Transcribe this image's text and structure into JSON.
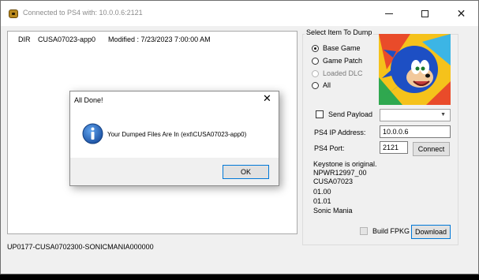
{
  "window": {
    "title": "Connected to PS4 with: 10.0.0.6:2121",
    "icon": "app-icon",
    "controls": [
      "minimize-icon",
      "maximize-icon",
      "close-icon"
    ]
  },
  "list": {
    "rows": [
      {
        "type": "DIR",
        "name": "CUSA07023-app0",
        "modified": "Modified : 7/23/2023 7:00:00 AM"
      }
    ]
  },
  "status": {
    "label": "UP0177-CUSA0702300-SONICMANIA000000"
  },
  "dump_panel": {
    "group_title": "Select Item To Dump",
    "options": [
      {
        "label": "Base Game",
        "checked": true,
        "enabled": true
      },
      {
        "label": "Game Patch",
        "checked": false,
        "enabled": true
      },
      {
        "label": "Loaded DLC",
        "checked": false,
        "enabled": false
      },
      {
        "label": "All",
        "checked": false,
        "enabled": true
      }
    ],
    "send_payload_label": "Send Payload",
    "payload_selected": "",
    "ip_label": "PS4 IP Address:",
    "ip_value": "10.0.0.6",
    "port_label": "PS4 Port:",
    "port_value": "2121",
    "connect_label": "Connect",
    "info_lines": [
      "Keystone is original.",
      "NPWR12997_00",
      "CUSA07023",
      "01.00",
      "01.01",
      "Sonic Mania"
    ],
    "build_fpkg_label": "Build FPKG",
    "download_label": "Download"
  },
  "dialog": {
    "title": "All Done!",
    "message": "Your Dumped Files Are In (ext\\CUSA07023-app0)",
    "ok_label": "OK",
    "icon": "info-icon"
  },
  "colors": {
    "accent": "#0078d7",
    "info_icon": "#1a5fb4"
  }
}
